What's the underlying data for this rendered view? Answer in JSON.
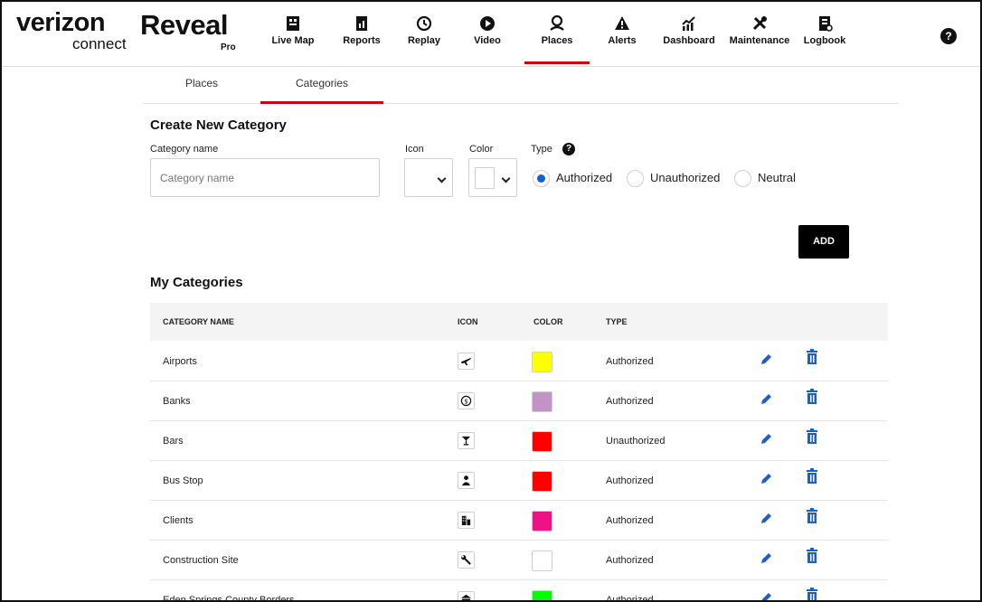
{
  "brand": {
    "company": "verizon",
    "company_sub": "connect",
    "product": "Reveal",
    "product_tier": "Pro"
  },
  "nav": [
    {
      "label": "Live Map",
      "icon": "live-map-icon"
    },
    {
      "label": "Reports",
      "icon": "reports-icon"
    },
    {
      "label": "Replay",
      "icon": "replay-icon"
    },
    {
      "label": "Video",
      "icon": "video-icon"
    },
    {
      "label": "Places",
      "icon": "places-icon",
      "active": true
    },
    {
      "label": "Alerts",
      "icon": "alerts-icon"
    },
    {
      "label": "Dashboard",
      "icon": "dashboard-icon"
    },
    {
      "label": "Maintenance",
      "icon": "maintenance-icon"
    },
    {
      "label": "Logbook",
      "icon": "logbook-icon"
    }
  ],
  "help": {
    "glyph": "?"
  },
  "tabs": [
    {
      "label": "Places"
    },
    {
      "label": "Categories",
      "active": true
    }
  ],
  "create": {
    "title": "Create New Category",
    "name_label": "Category name",
    "name_placeholder": "Category name",
    "name_value": "",
    "icon_label": "Icon",
    "color_label": "Color",
    "type_label": "Type",
    "type_help": "?",
    "types": [
      "Authorized",
      "Unauthorized",
      "Neutral"
    ],
    "selected_type": "Authorized",
    "add_label": "ADD"
  },
  "my_categories": {
    "title": "My Categories",
    "columns": [
      "CATEGORY NAME",
      "ICON",
      "COLOR",
      "TYPE"
    ],
    "rows": [
      {
        "name": "Airports",
        "icon": "airplane-icon",
        "color": "#ffff00",
        "type": "Authorized"
      },
      {
        "name": "Banks",
        "icon": "dollar-icon",
        "color": "#c393c7",
        "type": "Authorized"
      },
      {
        "name": "Bars",
        "icon": "cocktail-icon",
        "color": "#ff0000",
        "type": "Unauthorized"
      },
      {
        "name": "Bus Stop",
        "icon": "person-icon",
        "color": "#ff0000",
        "type": "Authorized"
      },
      {
        "name": "Clients",
        "icon": "building-icon",
        "color": "#ee1289",
        "type": "Authorized"
      },
      {
        "name": "Construction Site",
        "icon": "wrench-icon",
        "color": "#ffffff",
        "type": "Authorized"
      },
      {
        "name": "Eden Springs County Borders",
        "icon": "government-icon",
        "color": "#00ff00",
        "type": "Authorized"
      }
    ]
  },
  "colors": {
    "accent": "#cd040b",
    "radio": "#1360d6",
    "action_icons": "#1a5fcc"
  }
}
